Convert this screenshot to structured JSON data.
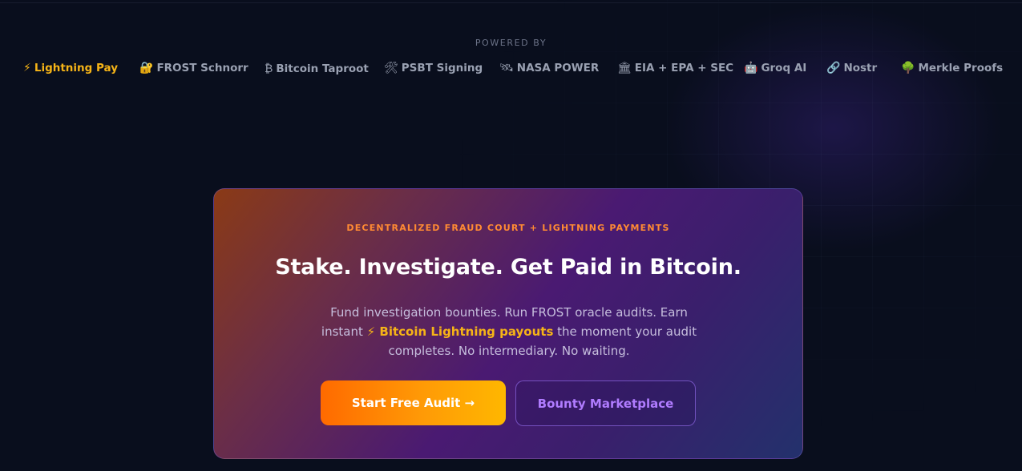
{
  "powered_by": {
    "label": "POWERED BY",
    "items": [
      {
        "icon": "⚡",
        "icon_name": "lightning-icon",
        "label": "Lightning Pay"
      },
      {
        "icon": "🔐",
        "icon_name": "lock-key-icon",
        "label": "FROST Schnorr"
      },
      {
        "icon": "₿",
        "icon_name": "bitcoin-icon",
        "label": "Bitcoin Taproot"
      },
      {
        "icon": "🛠",
        "icon_name": "tools-icon",
        "label": "PSBT Signing"
      },
      {
        "icon": "🛰",
        "icon_name": "satellite-icon",
        "label": "NASA POWER"
      },
      {
        "icon": "🏛",
        "icon_name": "classical-building-icon",
        "label": "EIA + EPA + SEC"
      },
      {
        "icon": "🤖",
        "icon_name": "robot-icon",
        "label": "Groq AI"
      },
      {
        "icon": "🔗",
        "icon_name": "link-icon",
        "label": "Nostr"
      },
      {
        "icon": "🌳",
        "icon_name": "tree-icon",
        "label": "Merkle Proofs"
      }
    ]
  },
  "hero": {
    "eyebrow": "DECENTRALIZED FRAUD COURT + LIGHTNING PAYMENTS",
    "title": "Stake. Investigate. Get Paid in Bitcoin.",
    "description_before": "Fund investigation bounties. Run FROST oracle audits. Earn instant ",
    "description_highlight": "⚡ Bitcoin Lightning payouts",
    "description_after": " the moment your audit completes. No intermediary. No waiting.",
    "primary_button": "Start Free Audit →",
    "secondary_button": "Bounty Marketplace"
  },
  "colors": {
    "background": "#090e1d",
    "accent_orange": "#ff8a33",
    "accent_gold": "#f6b417",
    "accent_purple": "#b07cff"
  }
}
